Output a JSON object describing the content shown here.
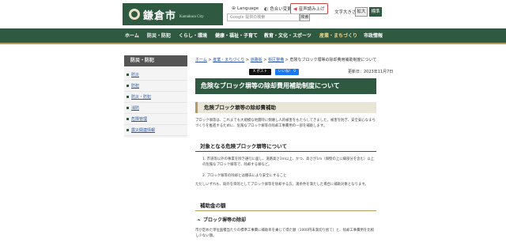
{
  "header": {
    "logo_text": "鎌倉市",
    "logo_sub": "Kamakura City",
    "language": "Language",
    "color_change": "色合い変更",
    "read_aloud": "音声読み上げ",
    "search_placeholder": "Google 提供の検索",
    "search_button": "検索",
    "font_size_label": "文字大きさ",
    "font_large": "拡大",
    "font_standard": "標準"
  },
  "nav": {
    "items": [
      "ホーム",
      "防災・防犯",
      "くらし・環境",
      "健康・福祉・子育て",
      "教育・文化・スポーツ",
      "産業・まちづくり",
      "市政情報"
    ],
    "active_index": 5
  },
  "breadcrumb": {
    "items": [
      "ホーム",
      "産業・まちづくり",
      "道路街",
      "街区整備",
      "危険なブロック塀等の除却費用補助制度について"
    ],
    "sep": ">"
  },
  "sidebar": {
    "heading": "防災・防犯",
    "items": [
      "防災",
      "防犯",
      "防災・防犯",
      "消防",
      "危険管理",
      "震災関連情報"
    ]
  },
  "content": {
    "sns_x": "X ポスト",
    "sns_fb": "いいね！ 0",
    "updated": "更新日：2023年11月7日",
    "title": "危険なブロック塀等の除却費用補助制度について",
    "section1": "危険ブロック塀等の除却費補助",
    "para1": "ブロック塀等は、これまでも大規模な地震時に倒壊し人的被害をもたらしてきました。被害を防ぎ、安全安心なまちづくりを推進するために、危険なブロック塀等の除却工事費用の一部を補助します。",
    "section2": "対象となる危険ブロック塀等について",
    "item1": "1. 市道等以外の事業を除き通行に面し、道路高さ1m以上、かつ、高さが1m（塀壁の上に縁部分を含む）以上の危険なブロック塀等で、除却する塀など。",
    "item2": "2. ブロック塀等の除却とは撤去により安全にすること",
    "para2": "ただしいずれも、既存を目的としてブロック塀等を除却する方。諸条件を満たした場合に補助対象となります。",
    "section3": "補助金の額",
    "sub1": "ブロック塀等の除却",
    "para3": "市が定めた単位面積当たりの標準工事費に補助率を乗じて得た額（1000円未満切り捨て）と、除却工事費用を比較し少ない額。"
  }
}
